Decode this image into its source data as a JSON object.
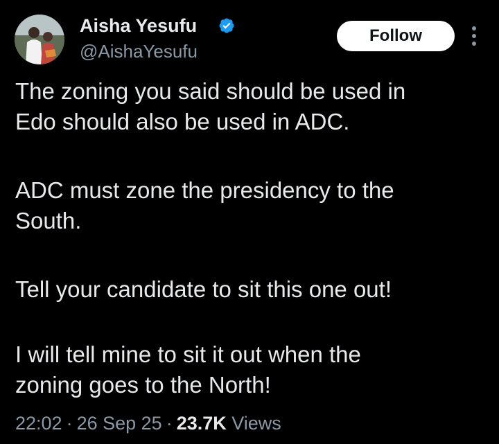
{
  "author": {
    "display_name": "Aisha Yesufu",
    "handle": "@AishaYesufu",
    "verified_icon": "verified-badge-icon",
    "verified_color": "#1d9bf0"
  },
  "actions": {
    "follow_label": "Follow",
    "more_icon": "more-vertical-icon"
  },
  "tweet": {
    "paragraphs": [
      "The zoning you said should be used in\nEdo should also be used in ADC.",
      "ADC must zone the presidency to the\nSouth.",
      "Tell your candidate to sit this one out!",
      "I will tell mine to sit it out when the\nzoning goes to the North!"
    ]
  },
  "meta": {
    "time": "22:02",
    "separator": "·",
    "date": "26 Sep 25",
    "views_count": "23.7K",
    "views_label": "Views"
  },
  "colors": {
    "background": "#000000",
    "text_primary": "#e7e9ea",
    "text_secondary": "#8b98a5",
    "follow_bg": "#ffffff"
  }
}
